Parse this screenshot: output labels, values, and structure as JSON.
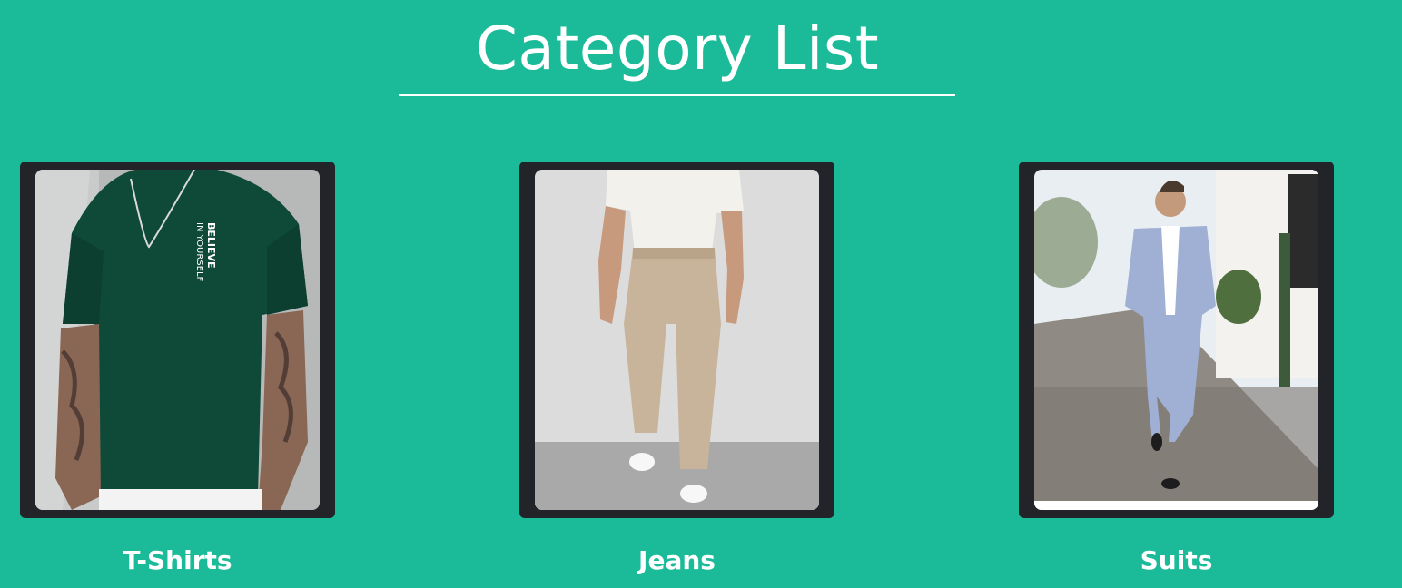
{
  "header": {
    "title": "Category List"
  },
  "categories": [
    {
      "label": "T-Shirts",
      "image": "green-tshirt-photo",
      "shirt_print": [
        "BELIEVE",
        "IN YOURSELF"
      ]
    },
    {
      "label": "Jeans",
      "image": "beige-trousers-photo"
    },
    {
      "label": "Suits",
      "image": "grey-suit-photo"
    }
  ],
  "colors": {
    "background": "#1bbb99",
    "card": "#232429",
    "text": "#ffffff"
  }
}
